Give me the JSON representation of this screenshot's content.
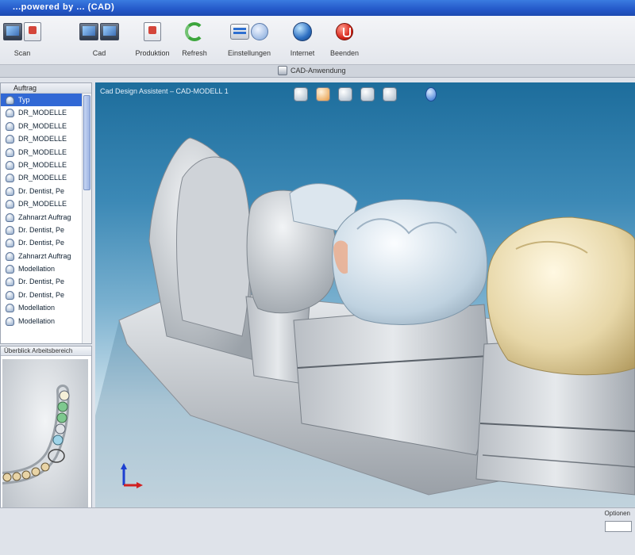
{
  "window": {
    "title": "...powered by ... (CAD)"
  },
  "toolbar": {
    "buttons": [
      {
        "label": "Scan",
        "icons": [
          "monitor-icon",
          "document-icon"
        ]
      },
      {
        "label": "Cad",
        "icons": [
          "monitor-icon",
          "monitor-icon"
        ]
      },
      {
        "label": "Produktion",
        "icons": [
          "document-icon"
        ]
      },
      {
        "label": "Refresh",
        "icons": [
          "refresh-icon"
        ]
      },
      {
        "label": "Einstellungen",
        "icons": [
          "settings-icon",
          "people-icon"
        ]
      },
      {
        "label": "Internet",
        "icons": [
          "globe-icon"
        ]
      },
      {
        "label": "Beenden",
        "icons": [
          "exit-icon"
        ]
      }
    ]
  },
  "modebar": {
    "label": "CAD-Anwendung"
  },
  "tree": {
    "header": "Auftrag",
    "selected_index": 0,
    "items": [
      "Typ",
      "DR_MODELLE",
      "DR_MODELLE",
      "DR_MODELLE",
      "DR_MODELLE",
      "DR_MODELLE",
      "DR_MODELLE",
      "Dr. Dentist, Pe",
      "DR_MODELLE",
      "Zahnarzt Auftrag",
      "Dr. Dentist, Pe",
      "Dr. Dentist, Pe",
      "Zahnarzt Auftrag",
      "Modellation",
      "Dr. Dentist, Pe",
      "Dr. Dentist, Pe",
      "Modellation",
      "Modellation"
    ]
  },
  "mini": {
    "tab": "Überblick Arbeitsbereich"
  },
  "viewport": {
    "title": "Cad Design Assistent – CAD-MODELL 1",
    "tools": [
      "undo-icon",
      "tooth-color-icon",
      "tooth-grid-icon",
      "edit-tool-icon",
      "tooth-shape-icon",
      "info-icon"
    ]
  },
  "statusbar": {
    "label": "Optionen"
  },
  "colors": {
    "titlebar": "#2458c8",
    "selection": "#3168d5",
    "viewport_top": "#1d6d9c",
    "crown": "#e9dcb3",
    "model": "#c9cdd2"
  }
}
